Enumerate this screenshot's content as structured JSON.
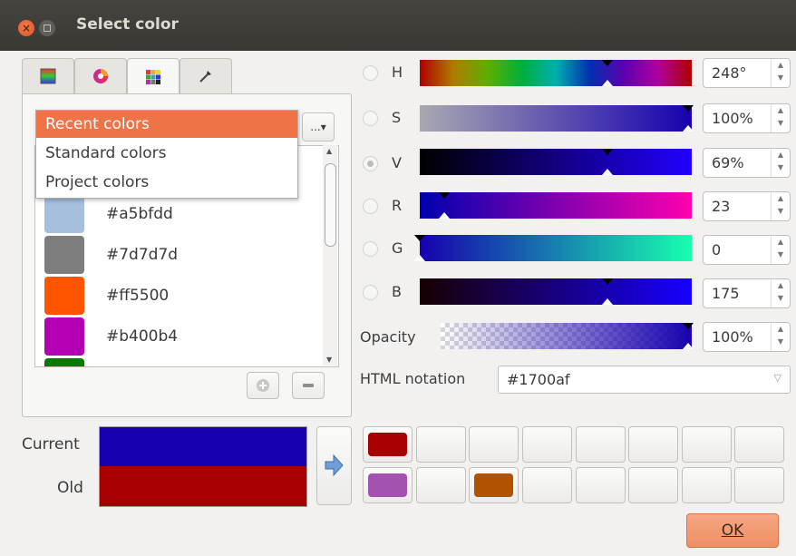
{
  "window": {
    "title": "Select color"
  },
  "tabs": [
    {
      "icon": "color-ramp-icon"
    },
    {
      "icon": "color-wheel-icon"
    },
    {
      "icon": "swatch-grid-icon"
    },
    {
      "icon": "eyedropper-icon"
    }
  ],
  "palette_dropdown": {
    "options": [
      "Recent colors",
      "Standard colors",
      "Project colors"
    ],
    "selected": "Recent colors",
    "menu_button_label": "...▾"
  },
  "swatches": [
    {
      "hex": "#a5bfdd",
      "color": "#a5bfdd"
    },
    {
      "hex": "#7d7d7d",
      "color": "#7d7d7d"
    },
    {
      "hex": "#ff5500",
      "color": "#ff5500"
    },
    {
      "hex": "#b400b4",
      "color": "#b400b4"
    },
    {
      "hex": "",
      "color": "#007a00"
    }
  ],
  "channels": [
    {
      "label": "H",
      "value": "248°",
      "level": 0.69,
      "checked": false
    },
    {
      "label": "S",
      "value": "100%",
      "level": 1.0,
      "checked": false
    },
    {
      "label": "V",
      "value": "69%",
      "level": 0.69,
      "checked": true
    },
    {
      "label": "R",
      "value": "23",
      "level": 0.09,
      "checked": false
    },
    {
      "label": "G",
      "value": "0",
      "level": 0.0,
      "checked": false
    },
    {
      "label": "B",
      "value": "175",
      "level": 0.69,
      "checked": false
    }
  ],
  "opacity": {
    "label": "Opacity",
    "value": "100%",
    "level": 1.0
  },
  "html_notation": {
    "label": "HTML notation",
    "value": "#1700af"
  },
  "preview": {
    "current_label": "Current",
    "old_label": "Old",
    "current_color": "#1700af",
    "old_color": "#a80000"
  },
  "saved_colors": [
    [
      "#a80000",
      "",
      "",
      "",
      "",
      "",
      "",
      ""
    ],
    [
      "#a452b0",
      "",
      "#b05300",
      "",
      "",
      "",
      "",
      ""
    ]
  ],
  "ok_button": "OK"
}
